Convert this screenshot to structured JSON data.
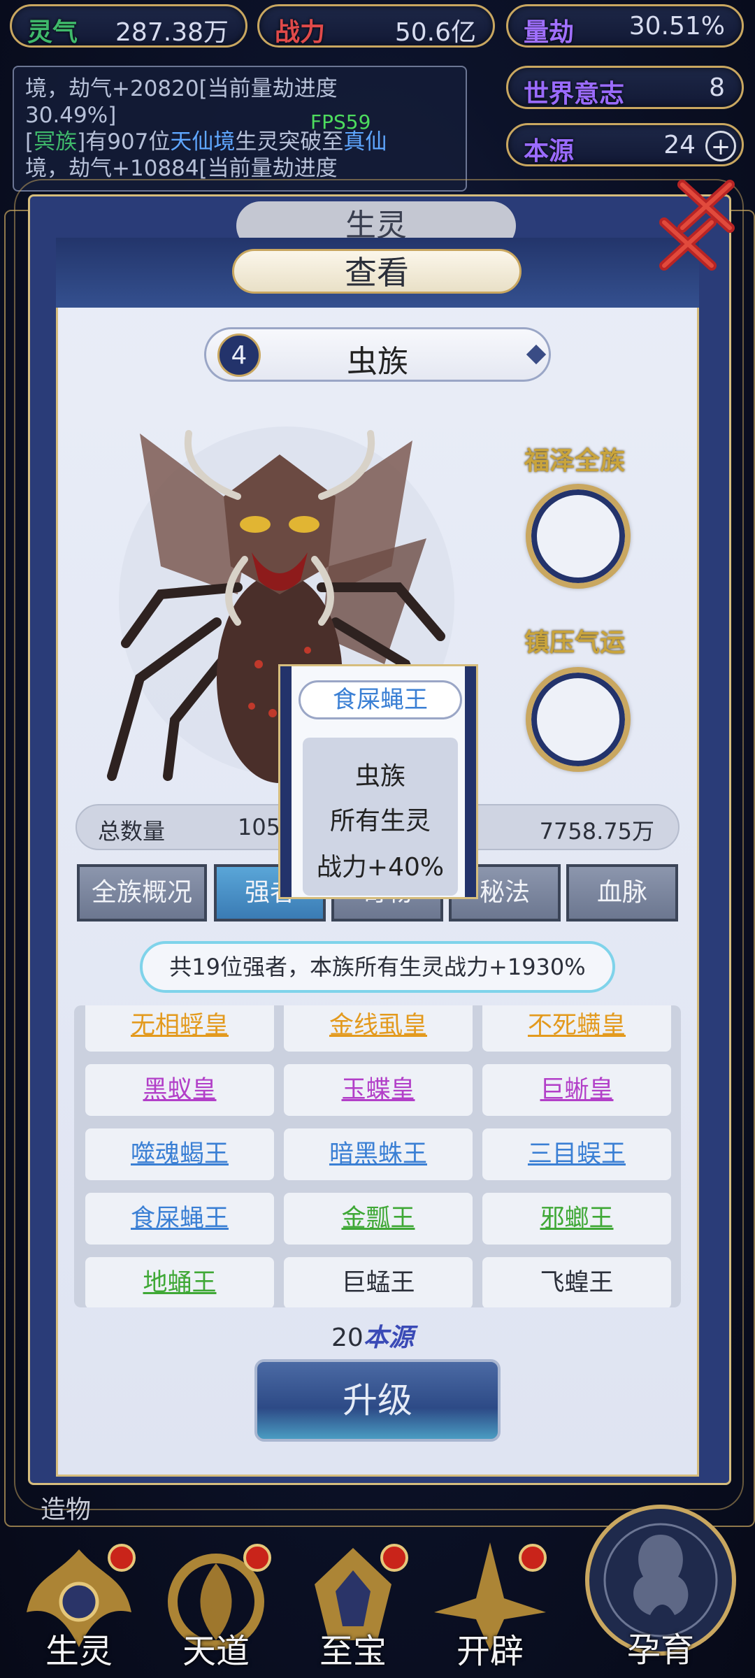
{
  "top_stats": {
    "lingqi": {
      "label": "灵气",
      "value": "287.38万"
    },
    "zhanli": {
      "label": "战力",
      "value": "50.6亿"
    },
    "liangjie": {
      "label": "量劫",
      "value": "30.51%"
    },
    "shijie_yizhi": {
      "label": "世界意志",
      "value": "8"
    },
    "benyuan": {
      "label": "本源",
      "value": "24",
      "plus": "+"
    }
  },
  "log": {
    "line1": "境，劫气+20820[当前量劫进度",
    "line2": "30.49%]",
    "line3_a": "[",
    "line3_race": "冥族",
    "line3_b": "]有907位",
    "line3_realm1": "天仙境",
    "line3_c": "生灵突破至",
    "line3_realm2": "真仙",
    "line4": "境，劫气+10884[当前量劫进度"
  },
  "fps": "FPS59",
  "panel": {
    "bg_title": "生灵",
    "title": "查看"
  },
  "race_selector": {
    "number": "4",
    "name": "虫族"
  },
  "badges": {
    "fuze": "福泽全族",
    "zhenya": "镇压气运"
  },
  "total": {
    "label": "总数量",
    "value1": "105",
    "value2": "7758.75万"
  },
  "tabs": [
    {
      "label": "全族概况"
    },
    {
      "label": "强者"
    },
    {
      "label": "奇物"
    },
    {
      "label": "秘法"
    },
    {
      "label": "血脉"
    }
  ],
  "summary": "共19位强者，本族所有生灵战力+1930%",
  "strongmen": [
    {
      "name": "无相蜉皇",
      "color": "#e39a1e"
    },
    {
      "name": "金线虱皇",
      "color": "#e39a1e"
    },
    {
      "name": "不死螨皇",
      "color": "#e39a1e"
    },
    {
      "name": "黑蚁皇",
      "color": "#b23fc8"
    },
    {
      "name": "玉蝶皇",
      "color": "#b23fc8"
    },
    {
      "name": "巨蜥皇",
      "color": "#b23fc8"
    },
    {
      "name": "噬魂蝎王",
      "color": "#3a7fd4"
    },
    {
      "name": "暗黑蛛王",
      "color": "#3a7fd4"
    },
    {
      "name": "三目蜈王",
      "color": "#3a7fd4"
    },
    {
      "name": "食屎蝇王",
      "color": "#3a7fd4"
    },
    {
      "name": "金瓢王",
      "color": "#3fa836"
    },
    {
      "name": "邪螂王",
      "color": "#3fa836"
    },
    {
      "name": "地蛹王",
      "color": "#3fa836"
    },
    {
      "name": "巨蜢王",
      "color": "#2b2f3a"
    },
    {
      "name": "飞蝗王",
      "color": "#2b2f3a"
    }
  ],
  "cost": {
    "amount": "20",
    "currency": "本源"
  },
  "upgrade_label": "升级",
  "tooltip": {
    "title": "食屎蝇王",
    "line1": "虫族",
    "line2": "所有生灵",
    "line3": "战力+40%"
  },
  "bottom_nav": {
    "zaowu": "造物",
    "items": [
      {
        "label": "生灵"
      },
      {
        "label": "天道"
      },
      {
        "label": "至宝"
      },
      {
        "label": "开辟"
      },
      {
        "label": "孕育"
      }
    ]
  }
}
